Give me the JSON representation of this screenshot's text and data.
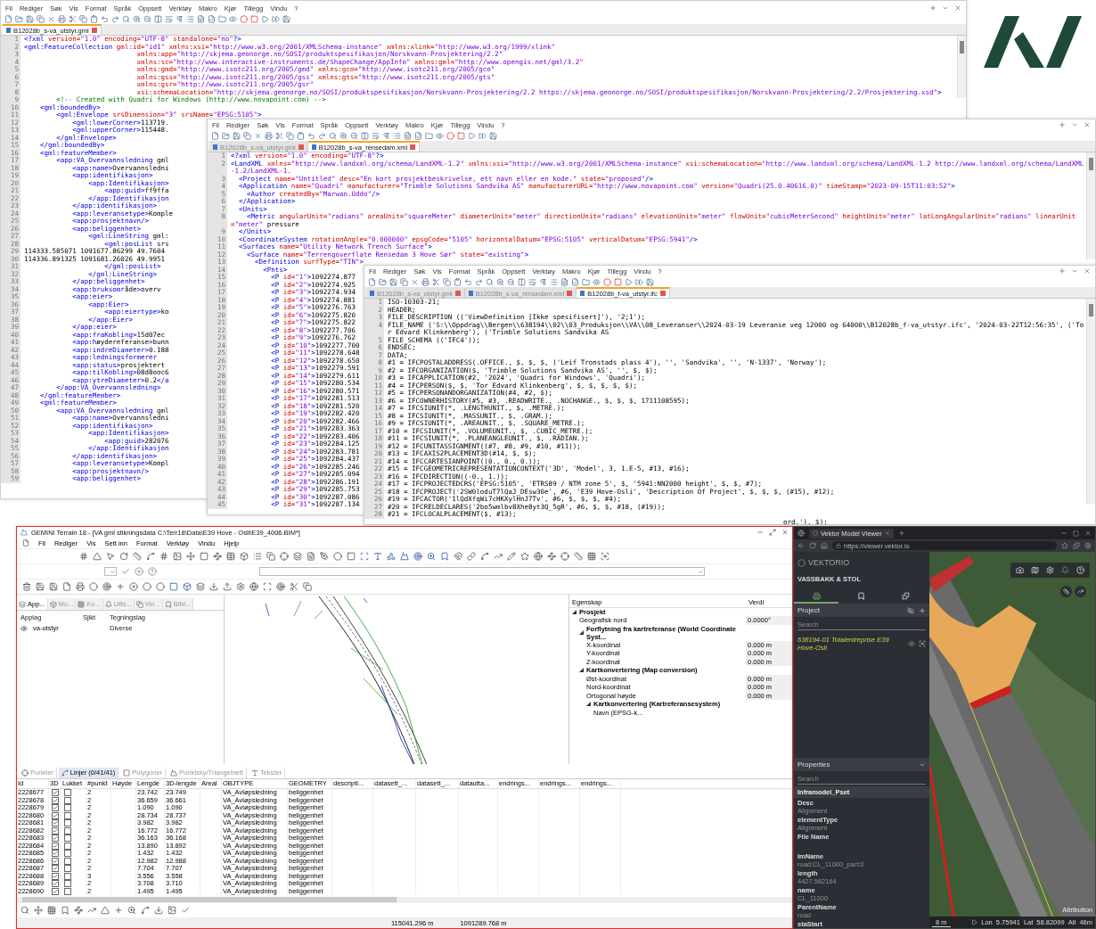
{
  "editors": [
    {
      "kind": "xml",
      "menu": [
        "Fil",
        "Rediger",
        "Søk",
        "Vis",
        "Format",
        "Språk",
        "Oppsett",
        "Verktøy",
        "Makro",
        "Kjør",
        "Tillegg",
        "Vindu",
        "?"
      ],
      "tabs": [
        {
          "label": "B12028b_s-va_utstyr.gml",
          "selected": true
        }
      ],
      "lines": [
        {
          "n": "1",
          "t": "<?xml version=\"1.0\" encoding=\"UTF-8\" standalone=\"no\"?>"
        },
        {
          "n": "2",
          "t": "<gml:FeatureCollection gml:id=\"id1\" xmlns:xsi=\"http://www.w3.org/2001/XMLSchema-instance\" xmlns:xlink=\"http://www.w3.org/1999/xlink\""
        },
        {
          "n": "3",
          "t": "                            xmlns:app=\"http://skjema.geonorge.no/SOSI/produktspesifikasjon/Norskvann-Prosjektering/2.2\""
        },
        {
          "n": "4",
          "t": "                            xmlns:sc=\"http://www.interactive-instruments.de/ShapeChange/AppInfo\" xmlns:gml=\"http://www.opengis.net/gml/3.2\""
        },
        {
          "n": "5",
          "t": "                            xmlns:gmd=\"http://www.isotc211.org/2005/gmd\" xmlns:gco=\"http://www.isotc211.org/2005/gco\""
        },
        {
          "n": "6",
          "t": "                            xmlns:gss=\"http://www.isotc211.org/2005/gss\" xmlns:gts=\"http://www.isotc211.org/2005/gts\""
        },
        {
          "n": "7",
          "t": "                            xmlns:gsr=\"http://www.isotc211.org/2005/gsr\""
        },
        {
          "n": "8",
          "t": "                            xsi:schemaLocation=\"http://skjema.geonorge.no/SOSI/produktspesifikasjon/Norskvann-Prosjektering/2.2 https://skjema.geonorge.no/SOSI/produktspesifikasjon/Norskvann-Prosjektering/2.2/Prosjektering.xsd\">"
        },
        {
          "n": "9",
          "t": "        <!-- Created with Quadri for Windows (http://www.novapoint.com) -->"
        },
        {
          "n": "10",
          "t": "    <gml:boundedBy>"
        },
        {
          "n": "11",
          "t": "        <gml:Envelope srsDimension=\"3\" srsName=\"EPSG:5105\">"
        },
        {
          "n": "12",
          "t": "            <gml:lowerCorner>113719."
        },
        {
          "n": "13",
          "t": "            <gml:upperCorner>115448."
        },
        {
          "n": "14",
          "t": "        </gml:Envelope>"
        },
        {
          "n": "15",
          "t": "    </gml:boundedBy>"
        },
        {
          "n": "16",
          "t": "    <gml:featureMember>"
        },
        {
          "n": "17",
          "t": "        <app:VA_Overvannsledning gml"
        },
        {
          "n": "18",
          "t": "            <app:name>Overvannsledni"
        },
        {
          "n": "19",
          "t": "            <app:identifikasjon>"
        },
        {
          "n": "20",
          "t": "                <app:Identifikasjon>"
        },
        {
          "n": "21",
          "t": "                    <app:guid>ff9ffa"
        },
        {
          "n": "22",
          "t": "                </app:Identifikasjon"
        },
        {
          "n": "23",
          "t": "            </app:identifikasjon>"
        },
        {
          "n": "24",
          "t": "            <app:leveransetype>Komple"
        },
        {
          "n": "25",
          "t": "            <app:prosjektnavn/>"
        },
        {
          "n": "26",
          "t": "            <app:beliggenhet>"
        },
        {
          "n": "27",
          "t": "                <gml:LineString gml:"
        },
        {
          "n": "28",
          "t": "                    <gml:posList srs"
        },
        {
          "n": "29",
          "t": "114333.585071 1091677.86299 49.7604"
        },
        {
          "n": "30",
          "t": "114336.891325 1091681.26026 49.9951"
        },
        {
          "n": "31",
          "t": "                    </gml:posList>"
        },
        {
          "n": "32",
          "t": "                </gml:LineString>"
        },
        {
          "n": "33",
          "t": "            </app:beliggenhet>"
        },
        {
          "n": "34",
          "t": "            <app:bruksområde>overv"
        },
        {
          "n": "35",
          "t": "            <app:eier>"
        },
        {
          "n": "36",
          "t": "                <app:Eier>"
        },
        {
          "n": "37",
          "t": "                    <app:eiertype>ko"
        },
        {
          "n": "38",
          "t": "                </app:Eier>"
        },
        {
          "n": "39",
          "t": "            </app:eier>"
        },
        {
          "n": "40",
          "t": "            <app:fraKobling>15d07ec"
        },
        {
          "n": "41",
          "t": "            <app:høydereferanse>bunn"
        },
        {
          "n": "42",
          "t": "            <app:indreDiameter>0.188"
        },
        {
          "n": "43",
          "t": "            <app:ledningsformerer"
        },
        {
          "n": "44",
          "t": "            <app:status>prosjektert"
        },
        {
          "n": "45",
          "t": "            <app:tilKobling>08d8ooc6"
        },
        {
          "n": "46",
          "t": "            <app:ytreDiameter>0.2</a"
        },
        {
          "n": "47",
          "t": "        </app:VA_Overvannsledning>"
        },
        {
          "n": "48",
          "t": "    </gml:featureMember>"
        },
        {
          "n": "49",
          "t": "    <gml:featureMember>"
        },
        {
          "n": "50",
          "t": "        <app:VA_Overvannsledning gml"
        },
        {
          "n": "51",
          "t": "            <app:name>Overvannsledni"
        },
        {
          "n": "52",
          "t": "            <app:identifikasjon>"
        },
        {
          "n": "53",
          "t": "                <app:Identifikasjon>"
        },
        {
          "n": "54",
          "t": "                    <app:guid>282076"
        },
        {
          "n": "55",
          "t": "                </app:Identifikasjon"
        },
        {
          "n": "56",
          "t": "            </app:identifikasjon>"
        },
        {
          "n": "57",
          "t": "            <app:leveransetype>Kompl"
        },
        {
          "n": "58",
          "t": "            <app:prosjektnavn/>"
        },
        {
          "n": "59",
          "t": "            <app:beliggenhet>"
        }
      ]
    },
    {
      "kind": "xml",
      "menu": [
        "Fil",
        "Rediger",
        "Søk",
        "Vis",
        "Format",
        "Språk",
        "Oppsett",
        "Verktøy",
        "Makro",
        "Kjør",
        "Tillegg",
        "Vindu",
        "?"
      ],
      "tabs": [
        {
          "label": "B12028b_s-va_utstyr.gml",
          "selected": false
        },
        {
          "label": "B12028b_s-va_rensedam.xml",
          "selected": true
        }
      ],
      "lines": [
        {
          "n": "1",
          "t": "<?xml version=\"1.0\" encoding=\"UTF-8\"?>"
        },
        {
          "n": "2",
          "t": "<LandXML xmlns=\"http://www.landxml.org/schema/LandXML-1.2\" xmlns:xsi=\"http://www.w3.org/2001/XMLSchema-instance\" xsi:schemaLocation=\"http://www.landxml.org/schema/LandXML-1.2 http://www.landxml.org/schema/LandXML-1.2/LandXML-1."
        },
        {
          "n": "3",
          "t": "  <Project name=\"Untitled\" desc=\"En kort prosjektbeskrivelse, ett navn eller en kode.\" state=\"proposed\"/>"
        },
        {
          "n": "4",
          "t": "  <Application name=\"Quadri\" manufacturer=\"Trimble Solutions Sandvika AS\" manufacturerURL=\"http://www.novapoint.com\" version=\"Quadri(25.0.40616.0)\" timeStamp=\"2023-09-15T11:03:52\">"
        },
        {
          "n": "5",
          "t": "    <Author createdBy=\"Marwan.Oddo\"/>"
        },
        {
          "n": "6",
          "t": "  </Application>"
        },
        {
          "n": "7",
          "t": "  <Units>"
        },
        {
          "n": "8",
          "t": "    <Metric angularUnit=\"radians\" areaUnit=\"squareMeter\" diameterUnit=\"meter\" directionUnit=\"radians\" elevationUnit=\"meter\" flowUnit=\"cubicMeterSecond\" heightUnit=\"meter\" latLongAngularUnit=\"radians\" linearUnit=\"meter\" pressure"
        },
        {
          "n": "9",
          "t": "  </Units>"
        },
        {
          "n": "10",
          "t": "  <CoordinateSystem rotationAngle=\"0.000000\" epsgCode=\"5105\" horizontalDatum=\"EPSG:5105\" verticalDatum=\"EPSG:5941\"/>"
        },
        {
          "n": "11",
          "t": "  <Surfaces name=\"Utility Network Trench Surface\">"
        },
        {
          "n": "12",
          "t": "    <Surface name=\"Terrengoverflate Rensedam 3 Hove Sør\" state=\"existing\">"
        },
        {
          "n": "13",
          "t": "      <Definition surfType=\"TIN\">"
        },
        {
          "n": "14",
          "t": "        <Pnts>"
        },
        {
          "n": "15",
          "t": "          <P id=\"1\">1092274.877"
        },
        {
          "n": "16",
          "t": "          <P id=\"2\">1092274.925"
        },
        {
          "n": "17",
          "t": "          <P id=\"3\">1092274.934"
        },
        {
          "n": "18",
          "t": "          <P id=\"4\">1092274.881"
        },
        {
          "n": "19",
          "t": "          <P id=\"5\">1092276.763"
        },
        {
          "n": "20",
          "t": "          <P id=\"6\">1092275.820"
        },
        {
          "n": "21",
          "t": "          <P id=\"7\">1092275.822"
        },
        {
          "n": "22",
          "t": "          <P id=\"8\">1092277.706"
        },
        {
          "n": "23",
          "t": "          <P id=\"9\">1092276.762"
        },
        {
          "n": "24",
          "t": "          <P id=\"10\">1092277.700"
        },
        {
          "n": "25",
          "t": "          <P id=\"11\">1092278.648"
        },
        {
          "n": "26",
          "t": "          <P id=\"12\">1092278.650"
        },
        {
          "n": "27",
          "t": "          <P id=\"13\">1092279.591"
        },
        {
          "n": "28",
          "t": "          <P id=\"14\">1092279.611"
        },
        {
          "n": "29",
          "t": "          <P id=\"15\">1092280.534"
        },
        {
          "n": "30",
          "t": "          <P id=\"16\">1092280.571"
        },
        {
          "n": "31",
          "t": "          <P id=\"17\">1092281.513"
        },
        {
          "n": "32",
          "t": "          <P id=\"18\">1092281.520"
        },
        {
          "n": "33",
          "t": "          <P id=\"19\">1092282.420"
        },
        {
          "n": "34",
          "t": "          <P id=\"20\">1092282.466"
        },
        {
          "n": "35",
          "t": "          <P id=\"21\">1092283.363"
        },
        {
          "n": "36",
          "t": "          <P id=\"22\">1092283.406"
        },
        {
          "n": "37",
          "t": "          <P id=\"23\">1092284.125"
        },
        {
          "n": "38",
          "t": "          <P id=\"24\">1092283.781"
        },
        {
          "n": "39",
          "t": "          <P id=\"25\">1092284.437"
        },
        {
          "n": "40",
          "t": "          <P id=\"26\">1092285.246"
        },
        {
          "n": "41",
          "t": "          <P id=\"27\">1092285.094"
        },
        {
          "n": "42",
          "t": "          <P id=\"28\">1092286.191"
        },
        {
          "n": "43",
          "t": "          <P id=\"29\">1092285.753"
        },
        {
          "n": "44",
          "t": "          <P id=\"30\">1092287.086"
        },
        {
          "n": "45",
          "t": "          <P id=\"31\">1092287.134"
        }
      ]
    },
    {
      "kind": "plain",
      "menu": [
        "Fil",
        "Rediger",
        "Søk",
        "Vis",
        "Format",
        "Språk",
        "Oppsett",
        "Verktøy",
        "Makro",
        "Kjør",
        "Tillegg",
        "Vindu",
        "?"
      ],
      "tabs": [
        {
          "label": "B12028b_s-va_utstyr.gml",
          "selected": false
        },
        {
          "label": "B12028b_s-va_rensedam.xml",
          "selected": false
        },
        {
          "label": "B12028b_f-va_utstyr.ifc",
          "selected": true
        }
      ],
      "lines": [
        {
          "n": "1",
          "t": "ISO-10303-21;"
        },
        {
          "n": "2",
          "t": "HEADER;"
        },
        {
          "n": "3",
          "t": "FILE_DESCRIPTION (('ViewDefinition [Ikke spesifisert]'), '2;1');"
        },
        {
          "n": "4",
          "t": "FILE_NAME ('S:\\\\Oppdrag\\\\Bergen\\\\638194\\\\02\\\\03_Produksjon\\\\VA\\\\08_Leveranser\\\\2024-03-19 Leveranse veg 12000 og 64000\\\\B12028b_f-va_utstyr.ifc', '2024-03-22T12:56:35', ('Tor Edvard Klinkenberg'), ('Trimble Solutions Sandvika AS"
        },
        {
          "n": "5",
          "t": "FILE_SCHEMA (('IFC4'));"
        },
        {
          "n": "6",
          "t": "ENDSEC;"
        },
        {
          "n": "7",
          "t": "DATA;"
        },
        {
          "n": "8",
          "t": "#1 = IFCPOSTALADDRESS(.OFFICE., $, $, $, ('Leif Tronstads plass 4'), '', 'Sandvika', '', 'N-1337', 'Norway');"
        },
        {
          "n": "9",
          "t": "#2 = IFCORGANIZATION($, 'Trimble Solutions Sandvika AS', '', $, $);"
        },
        {
          "n": "10",
          "t": "#3 = IFCAPPLICATION(#2, '2024', 'Quadri for Windows', 'Quadri');"
        },
        {
          "n": "11",
          "t": "#4 = IFCPERSON($, $, 'Tor Edvard Klinkenberg', $, $, $, $, $);"
        },
        {
          "n": "12",
          "t": "#5 = IFCPERSONANDORGANIZATION(#4, #2, $);"
        },
        {
          "n": "13",
          "t": "#6 = IFCOWNERHISTORY(#5, #3, .READWRITE., .NOCHANGE., $, $, $, 1711108595);"
        },
        {
          "n": "14",
          "t": "#7 = IFCSIUNIT(*, .LENGTHUNIT., $, .METRE.);"
        },
        {
          "n": "15",
          "t": "#8 = IFCSIUNIT(*, .MASSUNIT., $, .GRAM.);"
        },
        {
          "n": "16",
          "t": "#9 = IFCSIUNIT(*, .AREAUNIT., $, .SQUARE_METRE.);"
        },
        {
          "n": "17",
          "t": "#10 = IFCSIUNIT(*, .VOLUMEUNIT., $, .CUBIC_METRE.);"
        },
        {
          "n": "18",
          "t": "#11 = IFCSIUNIT(*, .PLANEANGLEUNIT., $, .RADIAN.);"
        },
        {
          "n": "19",
          "t": "#12 = IFCUNITASSIGNMENT((#7, #8, #9, #10, #11));"
        },
        {
          "n": "20",
          "t": "#13 = IFCAXIS2PLACEMENT3D(#14, $, $);"
        },
        {
          "n": "21",
          "t": "#14 = IFCCARTESIANPOINT((0., 0., 0.));"
        },
        {
          "n": "22",
          "t": "#15 = IFCGEOMETRICREPRESENTATIONCONTEXT('3D', 'Model', 3, 1.E-5, #13, #16);"
        },
        {
          "n": "23",
          "t": "#16 = IFCDIRECTION((-0., 1.));"
        },
        {
          "n": "24",
          "t": "#17 = IFCPROJECTEDCRS('EPSG:5105', 'ETRS89 / NTM zone 5', $, '5941:NN2000 height', $, $, #7);"
        },
        {
          "n": "25",
          "t": "#18 = IFCPROJECT('2SW0loduT7lQaJ_DEsw30e', #6, 'E39 Hove-Osli', 'Description Of Project', $, $, $, (#15), #12);"
        },
        {
          "n": "26",
          "t": "#19 = IFCACTOR('1lQdXfqWi7cHKXylHnJ7Tv', #6, $, $, $, #4);"
        },
        {
          "n": "27",
          "t": "#20 = IFCRELDECLARES('2bo5wmlbv8Xhe8yt3Q_5gR', #6, $, $, #18, (#19));"
        },
        {
          "n": "28",
          "t": "#21 = IFCLOCALPLACEMENT($, #13);"
        }
      ],
      "tail": "ord.'), $);"
    }
  ],
  "gemini": {
    "title": "GEMINI Terrain 18 - [VA gml stikningsdata  C:\\Terr18\\Data\\E39 Hove - Osli\\E39_4006.BIM*]",
    "menu": [
      "Fil",
      "Rediger",
      "Vis",
      "Sett inn",
      "Format",
      "Verktøy",
      "Vindu",
      "Hjelp"
    ],
    "left_tabs": [
      {
        "label": "App...",
        "selected": true
      },
      {
        "label": "Mo...",
        "selected": false
      },
      {
        "label": "Ko...",
        "selected": false
      },
      {
        "label": "Utfo...",
        "selected": false
      },
      {
        "label": "Vin...",
        "selected": false
      },
      {
        "label": "BIM...",
        "selected": false
      }
    ],
    "layer_columns": [
      "Applag",
      "Sjikt",
      "Tegningslag"
    ],
    "layers": [
      {
        "visible": true,
        "applag": "va-utstyr",
        "tegningslag": "Diverse"
      }
    ],
    "properties": {
      "columns": [
        "Egenskap",
        "Verdi"
      ],
      "tree": [
        {
          "label": "Prosjekt",
          "expanded": true,
          "children": [
            {
              "label": "Geografisk nord",
              "value": "0.0000°"
            },
            {
              "label": "Forflytning fra kartreferanse (World Coordinate Syst...",
              "expanded": true,
              "children": [
                {
                  "label": "X-koordinat",
                  "value": "0.000 m"
                },
                {
                  "label": "Y-koordinat",
                  "value": "0.000 m"
                },
                {
                  "label": "Z-koordinat",
                  "value": "0.000 m"
                }
              ]
            },
            {
              "label": "Kartkonvertering (Map conversion)",
              "expanded": true,
              "children": [
                {
                  "label": "Øst-koordinat",
                  "value": "0.000 m"
                },
                {
                  "label": "Nord-koordinat",
                  "value": "0.000 m"
                },
                {
                  "label": "Ortogonal høyde",
                  "value": "0.000 m"
                },
                {
                  "label": "Kartkonvertering (Kartreferansesystem)",
                  "expanded": true,
                  "children": [
                    {
                      "label": "Navn (EPSG-k..."
                    }
                  ]
                }
              ]
            }
          ]
        }
      ]
    },
    "bottom_tabs": [
      {
        "label": "Punkter",
        "selected": false
      },
      {
        "label": "Linjer (0/41/41)",
        "selected": true
      },
      {
        "label": "Polygoner",
        "selected": false
      },
      {
        "label": "Punktsky/Triangelnett",
        "selected": false
      },
      {
        "label": "Tekster",
        "selected": false
      }
    ],
    "columns": [
      "Id",
      "3D",
      "Lukket",
      "#punkt",
      "Høyde",
      "Lengde",
      "3D-lengde",
      "Areal",
      "OBJTYPE",
      "GEOMETRY",
      "descripti...",
      "datasett_...",
      "datasett_...",
      "datautta...",
      "endrings...",
      "endrings...",
      "endrings..."
    ],
    "rows": [
      {
        "id": "2228677",
        "three_d": true,
        "lukket": false,
        "punkt": "2",
        "lengde": "23.742",
        "lengde_3d": "23.749",
        "objtype": "VA_Avløpsledning",
        "geometry": "beliggenhet"
      },
      {
        "id": "2228678",
        "three_d": true,
        "lukket": false,
        "punkt": "2",
        "lengde": "36.659",
        "lengde_3d": "36.661",
        "objtype": "VA_Avløpsledning",
        "geometry": "beliggenhet"
      },
      {
        "id": "2228679",
        "three_d": true,
        "lukket": false,
        "punkt": "2",
        "lengde": "1.090",
        "lengde_3d": "1.090",
        "objtype": "VA_Avløpsledning",
        "geometry": "beliggenhet"
      },
      {
        "id": "2228680",
        "three_d": true,
        "lukket": false,
        "punkt": "2",
        "lengde": "28.734",
        "lengde_3d": "28.737",
        "objtype": "VA_Avløpsledning",
        "geometry": "beliggenhet"
      },
      {
        "id": "2228681",
        "three_d": true,
        "lukket": false,
        "punkt": "2",
        "lengde": "3.982",
        "lengde_3d": "3.982",
        "objtype": "VA_Avløpsledning",
        "geometry": "beliggenhet"
      },
      {
        "id": "2228682",
        "three_d": true,
        "lukket": false,
        "punkt": "2",
        "lengde": "16.772",
        "lengde_3d": "16.772",
        "objtype": "VA_Avløpsledning",
        "geometry": "beliggenhet"
      },
      {
        "id": "2228683",
        "three_d": true,
        "lukket": false,
        "punkt": "2",
        "lengde": "36.163",
        "lengde_3d": "36.168",
        "objtype": "VA_Avløpsledning",
        "geometry": "beliggenhet"
      },
      {
        "id": "2228684",
        "three_d": true,
        "lukket": false,
        "punkt": "2",
        "lengde": "13.890",
        "lengde_3d": "13.892",
        "objtype": "VA_Avløpsledning",
        "geometry": "beliggenhet"
      },
      {
        "id": "2228685",
        "three_d": true,
        "lukket": false,
        "punkt": "2",
        "lengde": "1.432",
        "lengde_3d": "1.432",
        "objtype": "VA_Avløpsledning",
        "geometry": "beliggenhet"
      },
      {
        "id": "2228686",
        "three_d": true,
        "lukket": false,
        "punkt": "2",
        "lengde": "12.982",
        "lengde_3d": "12.988",
        "objtype": "VA_Avløpsledning",
        "geometry": "beliggenhet"
      },
      {
        "id": "2228687",
        "three_d": true,
        "lukket": false,
        "punkt": "2",
        "lengde": "7.704",
        "lengde_3d": "7.707",
        "objtype": "VA_Avløpsledning",
        "geometry": "beliggenhet"
      },
      {
        "id": "2228688",
        "three_d": true,
        "lukket": false,
        "punkt": "3",
        "lengde": "3.556",
        "lengde_3d": "3.558",
        "objtype": "VA_Avløpsledning",
        "geometry": "beliggenhet"
      },
      {
        "id": "2228689",
        "three_d": true,
        "lukket": false,
        "punkt": "2",
        "lengde": "3.708",
        "lengde_3d": "3.710",
        "objtype": "VA_Avløpsledning",
        "geometry": "beliggenhet"
      },
      {
        "id": "2228690",
        "three_d": true,
        "lukket": false,
        "punkt": "2",
        "lengde": "1.495",
        "lengde_3d": "1.495",
        "objtype": "VA_Avløpsledning",
        "geometry": "beliggenhet"
      }
    ],
    "status": [
      "115041.296 m",
      "1091289.768 m"
    ]
  },
  "viewer": {
    "tab": "Vektor Model Viewer",
    "url": "https://viewer.vektor.io",
    "brand": "VEKTORIO",
    "company": "VASSBAKK & STOL",
    "nav": [
      {
        "kind": "project",
        "selected": true
      },
      {
        "kind": "bookmark",
        "selected": false
      },
      {
        "kind": "plugin",
        "selected": false
      }
    ],
    "project_title": "Project",
    "project_search": {
      "placeholder": "Search"
    },
    "project_items": [
      {
        "label": "638194-01 Totalentreprise E39 Hove-Osli",
        "visible": true
      }
    ],
    "properties_title": "Properties",
    "properties_search": {
      "placeholder": "Search"
    },
    "pset": "Inframodel_Pset",
    "props": [
      {
        "key": "Desc",
        "value": "Alignment"
      },
      {
        "key": "elementType",
        "value": "Alignment"
      },
      {
        "key": "File Name"
      },
      {
        "key": "ImName",
        "value": "road:CL_11000_part:0"
      },
      {
        "key": "length",
        "value": "4427.562164"
      },
      {
        "key": "name",
        "value": "CL_11000"
      },
      {
        "key": "ParentName",
        "value": "road"
      },
      {
        "key": "staStart"
      }
    ],
    "attribution": "Attribution",
    "scale": "8 m",
    "coords": [
      {
        "label": "Lon",
        "value": "5.75941"
      },
      {
        "label": "Lat",
        "value": "58.82099"
      },
      {
        "label": "Alt",
        "value": "46m"
      }
    ]
  }
}
